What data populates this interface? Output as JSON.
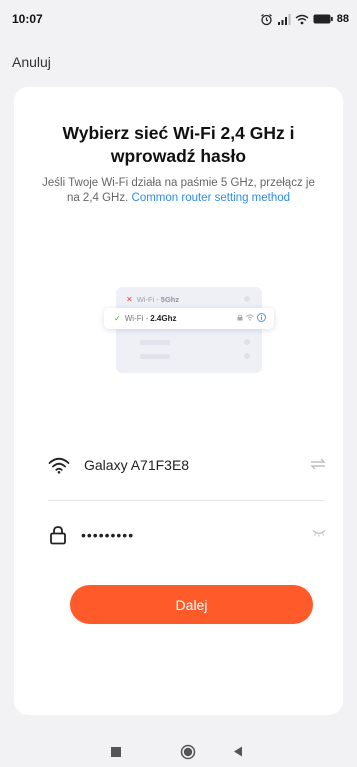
{
  "status_bar": {
    "time": "10:07",
    "battery": "88",
    "icons": [
      "alarm-icon",
      "signal-icon",
      "wifi-icon",
      "battery-icon"
    ]
  },
  "header": {
    "cancel_label": "Anuluj"
  },
  "content": {
    "title": "Wybierz sieć Wi-Fi 2,4 GHz i wprowadź hasło",
    "description": "Jeśli Twoje Wi-Fi działa na paśmie 5 GHz, przełącz je na 2,4 GHz.",
    "link_text": "Common router setting method"
  },
  "illustration": {
    "row_5ghz_prefix": "Wi-Fi - ",
    "row_5ghz_band": "5Ghz",
    "row_24ghz_prefix": "Wi-Fi - ",
    "row_24ghz_band": "2.4Ghz"
  },
  "form": {
    "wifi_name": "Galaxy A71F3E8",
    "password_value": "•••••••••"
  },
  "actions": {
    "next_label": "Dalej"
  },
  "colors": {
    "accent": "#ff5b2a",
    "link": "#2f8cf0",
    "background": "#f2f2f4",
    "card": "#ffffff"
  }
}
